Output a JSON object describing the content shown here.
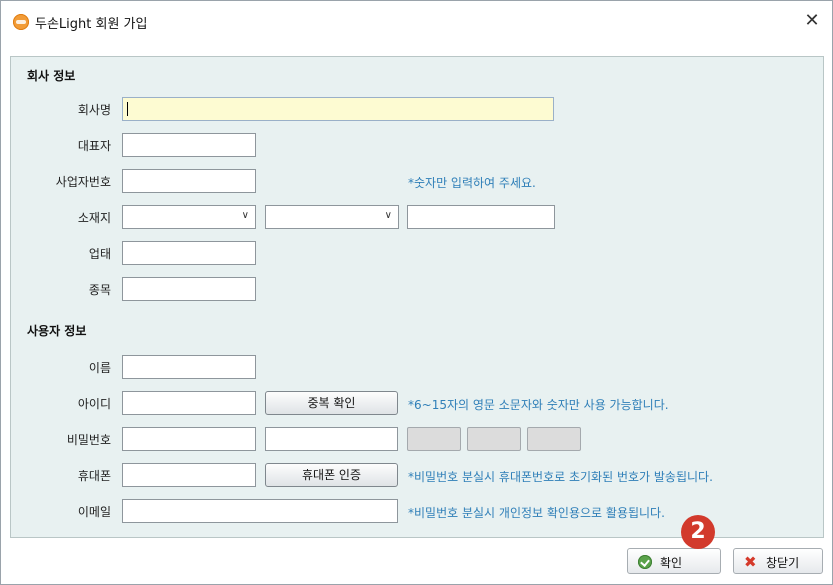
{
  "window": {
    "title": "두손Light 회원 가입",
    "close_glyph": "✕",
    "app_icon": "app-logo-icon"
  },
  "company_section": {
    "title": "회사 정보",
    "company_name_label": "회사명",
    "company_name_value": "",
    "ceo_label": "대표자",
    "ceo_value": "",
    "biz_no_label": "사업자번호",
    "biz_no_value": "",
    "biz_no_hint": "*숫자만 입력하여 주세요.",
    "location_label": "소재지",
    "location_select1": "",
    "location_select2": "",
    "location_detail": "",
    "business_type_label": "업태",
    "business_type_value": "",
    "item_label": "종목",
    "item_value": ""
  },
  "user_section": {
    "title": "사용자 정보",
    "name_label": "이름",
    "name_value": "",
    "id_label": "아이디",
    "id_value": "",
    "dup_check_button": "중복 확인",
    "id_hint": "*6~15자의 영문 소문자와 숫자만 사용 가능합니다.",
    "password_label": "비밀번호",
    "password_value": "",
    "password_confirm_value": "",
    "phone_label": "휴대폰",
    "phone_value": "",
    "phone_verify_button": "휴대폰 인증",
    "phone_hint": "*비밀번호 분실시 휴대폰번호로 초기화된 번호가 발송됩니다.",
    "email_label": "이메일",
    "email_value": "",
    "email_hint": "*비밀번호 분실시 개인정보 확인용으로 활용됩니다."
  },
  "footer": {
    "ok_label": "확인",
    "close_label": "창닫기"
  },
  "annotation": {
    "step_number": "2"
  },
  "colors": {
    "hint": "#2f7fb8",
    "panel": "#e8f1f1",
    "focus_field": "#fdfbd2",
    "badge": "#d23a2c"
  }
}
